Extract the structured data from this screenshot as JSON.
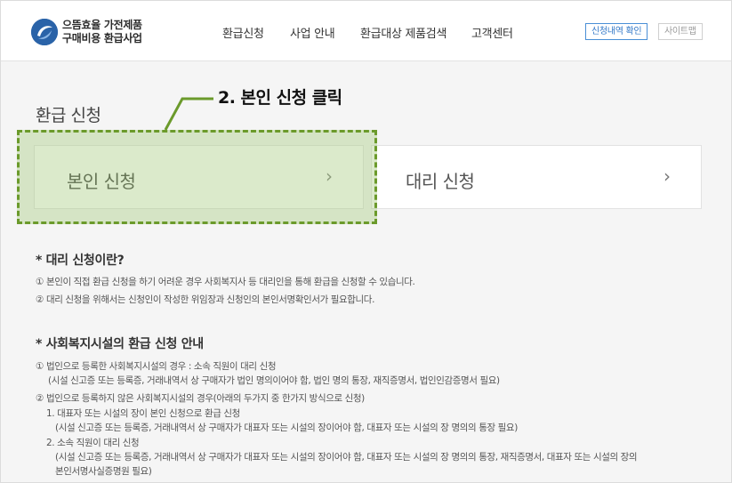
{
  "header": {
    "logo_line1": "으뜸효율 가전제품",
    "logo_line2": "구매비용 환급사업",
    "nav": [
      "환급신청",
      "사업 안내",
      "환급대상 제품검색",
      "고객센터"
    ],
    "btn_check": "신청내역 확인",
    "btn_sitemap": "사이트맵"
  },
  "main": {
    "title": "환급 신청",
    "card_self": "본인 신청",
    "card_proxy": "대리 신청",
    "chevron": "›"
  },
  "annotation": {
    "callout": "2. 본인 신청 클릭",
    "color": "#6b9a2b"
  },
  "info": {
    "proxy_title": "* 대리 신청이란?",
    "proxy_lines": [
      "① 본인이 직접 환급 신청을 하기 어려운 경우 사회복지사 등 대리인을 통해 환급을 신청할 수 있습니다.",
      "② 대리 신청을 위해서는 신청인이 작성한 위임장과 신청인의 본인서명확인서가 필요합니다."
    ],
    "welfare_title": "* 사회복지시설의 환급 신청 안내",
    "welfare_lines": [
      "① 법인으로 등록한 사회복지시설의 경우 : 소속 직원이 대리 신청",
      "(시설 신고증 또는 등록증, 거래내역서 상 구매자가 법인 명의이어야 함, 법인 명의 통장, 재직증명서, 법인인감증명서 필요)",
      "② 법인으로 등록하지 않은 사회복지시설의 경우(아래의 두가지 중 한가지 방식으로 신청)",
      "1. 대표자 또는 시설의 장이 본인 신청으로 환급 신청",
      "(시설 신고증 또는 등록증, 거래내역서 상 구매자가 대표자 또는 시설의 장이어야 함, 대표자 또는 시설의 장 명의의 통장 필요)",
      "2. 소속 직원이 대리 신청",
      "(시설 신고증 또는 등록증, 거래내역서 상 구매자가 대표자 또는 시설의 장이어야 함, 대표자 또는 시설의 장 명의의 통장, 재직증명서, 대표자 또는 시설의 장의",
      "본인서명사실증명원 필요)"
    ]
  }
}
